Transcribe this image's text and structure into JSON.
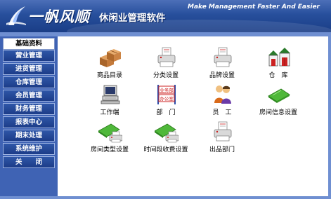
{
  "header": {
    "brand": "一帆风顺",
    "brand_sub": "休闲业管理软件",
    "slogan": "Make Management Faster And Easier"
  },
  "sidebar": {
    "items": [
      {
        "label": "基础资料",
        "active": true
      },
      {
        "label": "营业管理"
      },
      {
        "label": "进货管理"
      },
      {
        "label": "仓库管理"
      },
      {
        "label": "会员管理"
      },
      {
        "label": "财务管理"
      },
      {
        "label": "报表中心"
      },
      {
        "label": "期末处理"
      },
      {
        "label": "系统维护"
      },
      {
        "label": "关　　闭"
      }
    ]
  },
  "modules": [
    {
      "label": "商品目录",
      "icon": "boxes-icon"
    },
    {
      "label": "分类设置",
      "icon": "printer-icon"
    },
    {
      "label": "品牌设置",
      "icon": "printer-icon"
    },
    {
      "label": "仓　库",
      "icon": "warehouse-icon"
    },
    {
      "label": "工作端",
      "icon": "computer-icon"
    },
    {
      "label": "部　门",
      "icon": "department-icon"
    },
    {
      "label": "员　工",
      "icon": "staff-icon"
    },
    {
      "label": "房间信息设置",
      "icon": "card-icon"
    },
    {
      "label": "房间类型设置",
      "icon": "card-printer-icon"
    },
    {
      "label": "时间段收费设置",
      "icon": "card-printer-icon"
    },
    {
      "label": "出品部门",
      "icon": "printer-icon"
    }
  ],
  "dept_sign": {
    "top": "业务部",
    "bottom": "办公室"
  },
  "colors": {
    "header": "#274f9c",
    "sidebar": "#3f63b4",
    "frame": "#6f8fd1",
    "nav_button": "#1c3c88",
    "icon_green": "#4fb83a"
  }
}
